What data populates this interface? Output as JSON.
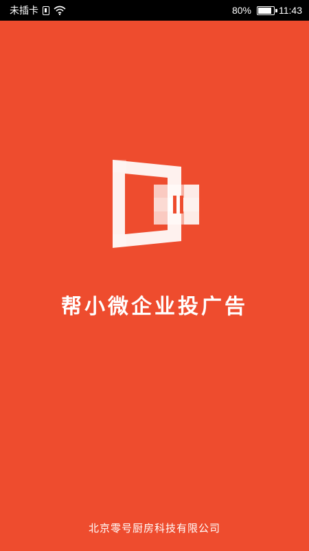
{
  "status_bar": {
    "carrier": "未插卡",
    "battery": "80%",
    "battery_level": 0.8,
    "time": "11:43",
    "icons": [
      "sim-icon",
      "wifi-icon",
      "battery-icon"
    ]
  },
  "splash": {
    "logo": "app-logo",
    "title": "帮小微企业投广告",
    "company": "北京零号厨房科技有限公司",
    "background_color": "#ee4c2e",
    "text_color": "#ffffff"
  }
}
